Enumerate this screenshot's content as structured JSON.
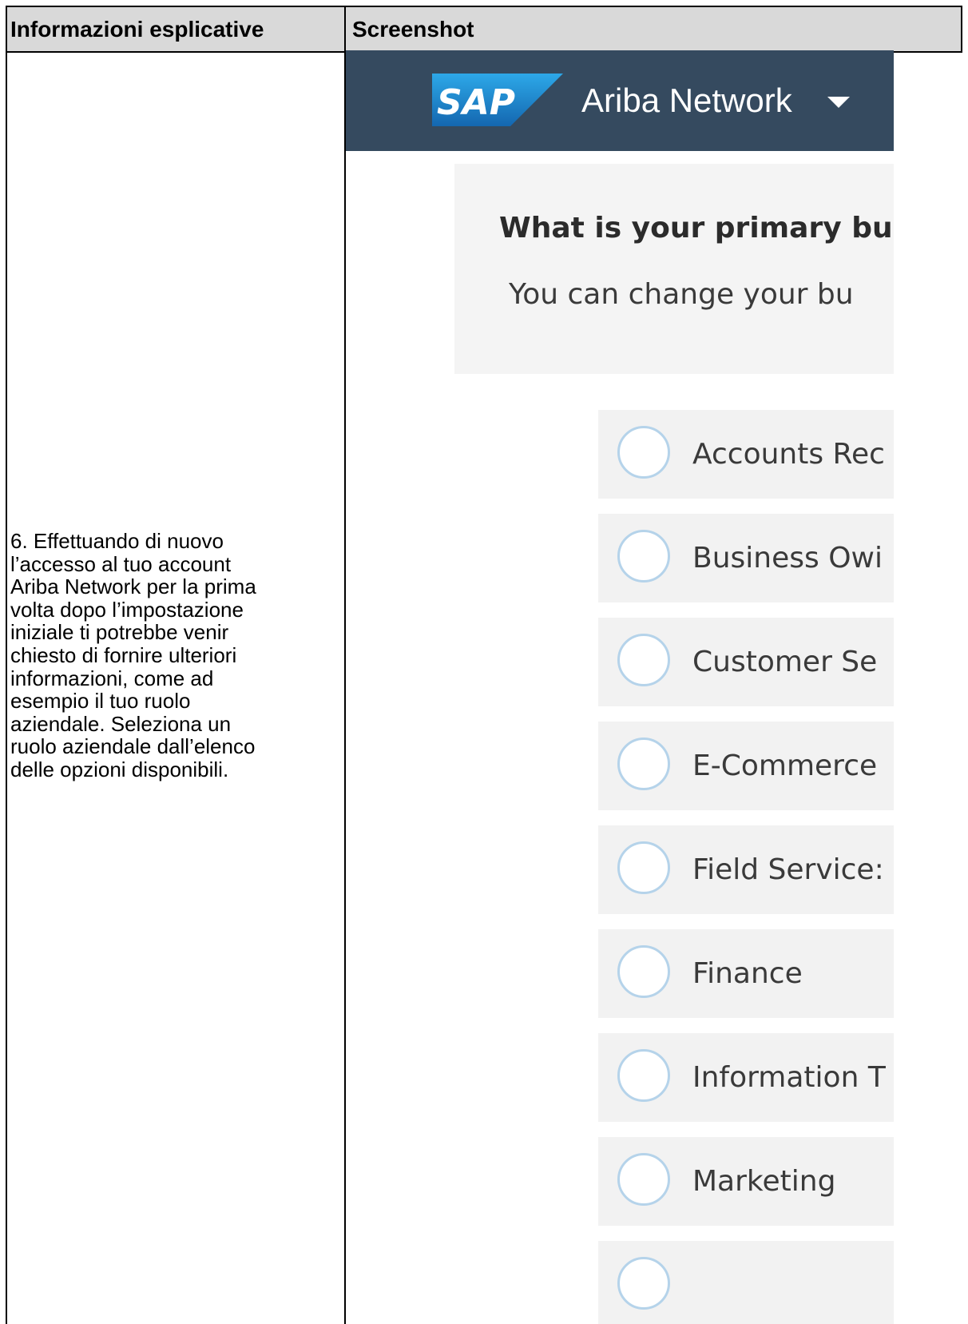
{
  "table": {
    "header_left": "Informazioni esplicative",
    "header_right": "Screenshot",
    "instructions": "6. Effettuando di nuovo\nl’accesso al tuo account\nAriba Network per la prima\nvolta dopo l’impostazione\niniziale ti potrebbe venir\nchiesto di fornire ulteriori\ninformazioni, come ad\nesempio il tuo ruolo\naziendale. Seleziona un\nruolo aziendale dall’elenco\ndelle opzioni disponibili."
  },
  "app": {
    "logo_text": "SAP",
    "brand_name": "Ariba Network",
    "header_color": "#354a5f",
    "logo_color": "#1b7ec2",
    "radio_border_color": "#b5d3ea"
  },
  "question": {
    "title": "What is your primary bus",
    "subtitle": "You can change your bu"
  },
  "roles": [
    {
      "label": "Accounts Rec"
    },
    {
      "label": "Business Owi"
    },
    {
      "label": "Customer Se"
    },
    {
      "label": "E-Commerce"
    },
    {
      "label": "Field Service:"
    },
    {
      "label": "Finance"
    },
    {
      "label": "Information T"
    },
    {
      "label": "Marketing"
    },
    {
      "label": ""
    }
  ]
}
